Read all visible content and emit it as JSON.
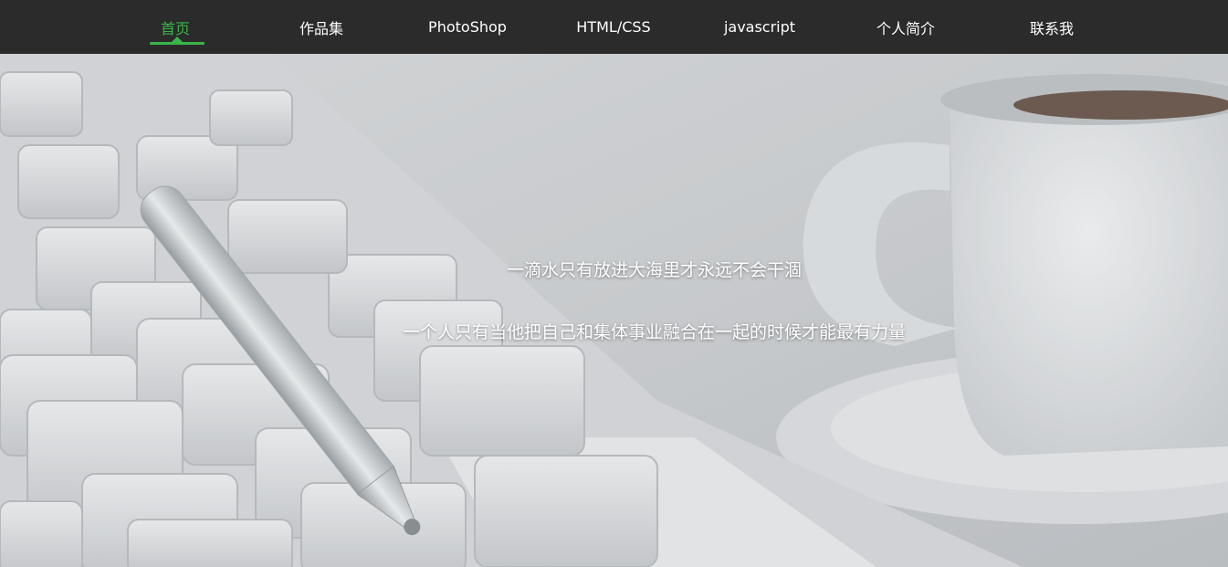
{
  "nav": {
    "items": [
      {
        "label": "首页",
        "active": true
      },
      {
        "label": "作品集",
        "active": false
      },
      {
        "label": "PhotoShop",
        "active": false
      },
      {
        "label": "HTML/CSS",
        "active": false
      },
      {
        "label": "javascript",
        "active": false
      },
      {
        "label": "个人简介",
        "active": false
      },
      {
        "label": "联系我",
        "active": false
      }
    ],
    "accent_color": "#39b54a",
    "background_color": "#2b2b2b"
  },
  "hero": {
    "line1": "一滴水只有放进大海里才永远不会干涸",
    "line2": "一个人只有当他把自己和集体事业融合在一起的时候才能最有力量",
    "background_image": "keyboard-pen-coffee-cup-photo"
  }
}
